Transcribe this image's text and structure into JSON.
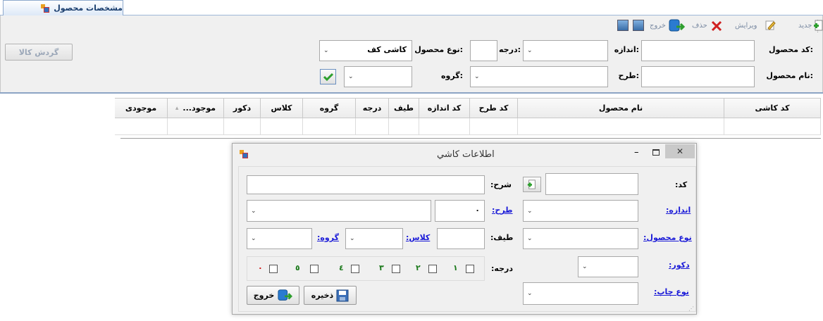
{
  "tab": {
    "title": "مشخصات محصول"
  },
  "toolbar": {
    "new_label": "جديد",
    "edit_label": "ويرايش",
    "delete_label": "حذف",
    "exit_label": "خروج"
  },
  "filter": {
    "product_code_label": "كد محصول:",
    "size_label": "اندازه:",
    "grade_label": "درجه:",
    "product_type_label": "نوع محصول:",
    "product_type_value": "كاشى كف",
    "product_name_label": "نام محصول:",
    "design_label": "طرح:",
    "group_label": "گروه:",
    "goods_flow_button": "گردش كالا"
  },
  "grid": {
    "columns": [
      "كد كاشى",
      "نام محصول",
      "كد طرح",
      "كد اندازه",
      "طيف",
      "درجه",
      "گروه",
      "كلاس",
      "دكور",
      "موجود...",
      "موجودى"
    ]
  },
  "dialog": {
    "title": "اطلاعات كاشي",
    "code_label": "كد:",
    "description_label": "شرح:",
    "size_label": "اندازه:",
    "design_label": "طرح:",
    "design_value": "٠",
    "product_type_label": "نوع محصول:",
    "shade_label": "طيف:",
    "class_label": "كلاس:",
    "group_label": "گروه:",
    "decor_label": "دكور:",
    "grade_label": "درجه:",
    "grades": [
      "١",
      "٢",
      "٣",
      "٤",
      "٥",
      "٠"
    ],
    "print_type_label": "نوع چاپ:",
    "save_button": "ذخيره",
    "exit_button": "خروج"
  },
  "colors": {
    "link": "#1a1ad8",
    "grade_numbers": "#1d7a1d",
    "grade_zero": "#cc0000"
  }
}
